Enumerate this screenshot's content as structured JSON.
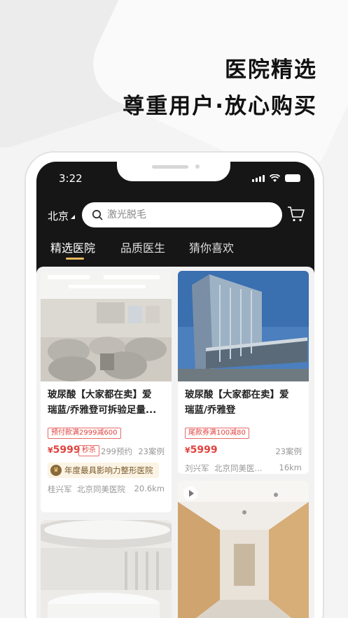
{
  "headline": {
    "line1": "医院精选",
    "line2": "尊重用户·放心购买"
  },
  "status_bar": {
    "time": "3:22"
  },
  "search": {
    "city": "北京",
    "placeholder": "激光脱毛"
  },
  "tabs": [
    {
      "label": "精选医院",
      "active": true
    },
    {
      "label": "品质医生",
      "active": false
    },
    {
      "label": "猜你喜欢",
      "active": false
    }
  ],
  "cards": [
    {
      "title_line1": "玻尿酸【大家都在卖】爱",
      "title_line2": "瑞蓝/乔雅登可拆验足量...",
      "promo": "预付款满2999减600",
      "price": "5999",
      "currency": "¥",
      "flash_tag": "秒杀",
      "appointments": "299预约",
      "cases": "23案例",
      "award": "年度最具影响力整形医院",
      "doctor": "桂兴军",
      "hospital": "北京同美医院",
      "distance": "20.6km"
    },
    {
      "title_line1": "玻尿酸【大家都在卖】爱",
      "title_line2": "瑞蓝/乔雅登",
      "promo": "尾款券满100减80",
      "price": "5999",
      "currency": "¥",
      "cases": "23案例",
      "doctor": "刘兴军",
      "hospital": "北京同美医...",
      "distance": "16km"
    }
  ],
  "colors": {
    "accent": "#e7b85d",
    "price_red": "#e0433f",
    "dark_bg": "#161616"
  }
}
